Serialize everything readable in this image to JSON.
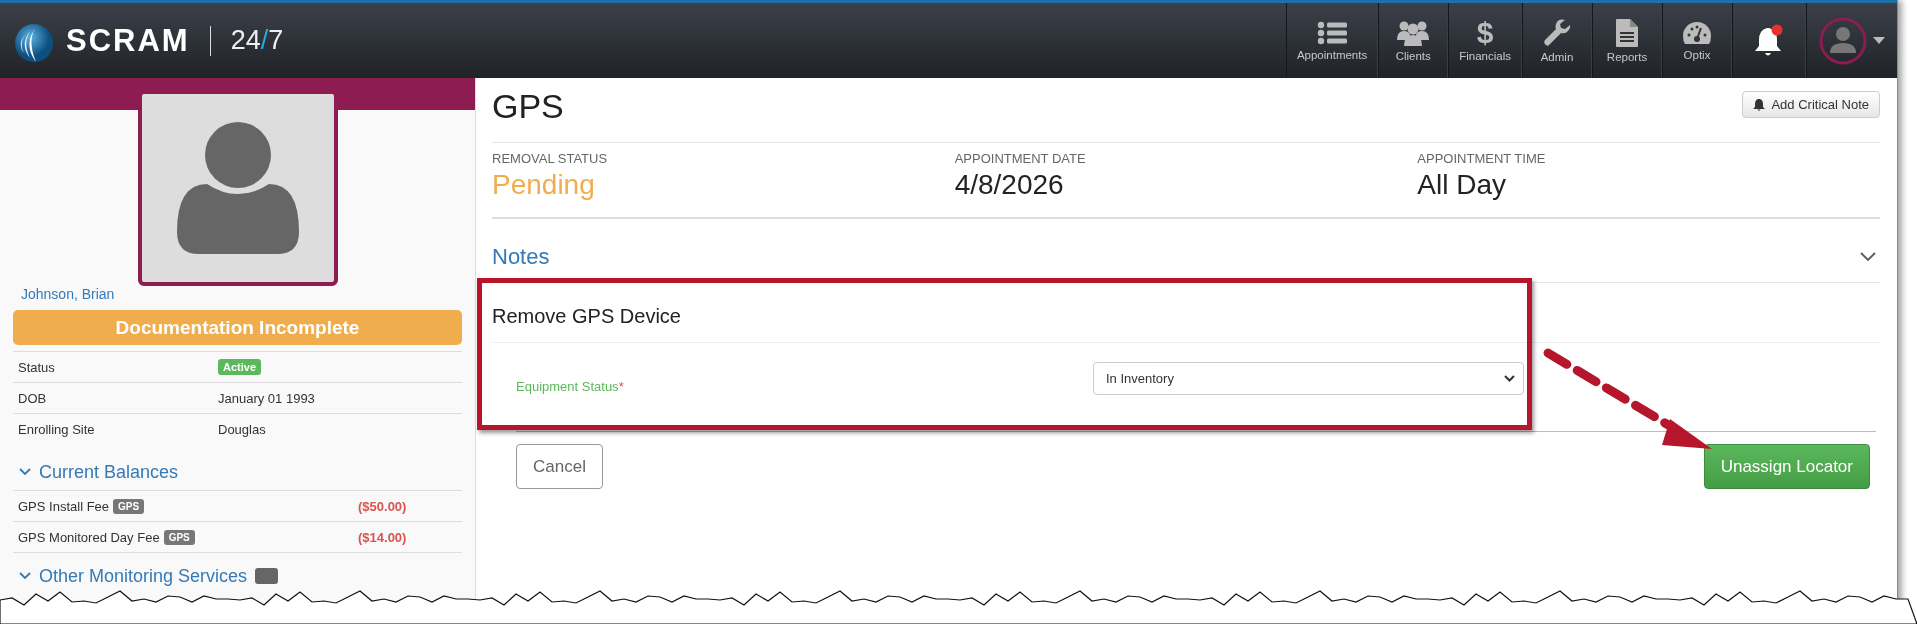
{
  "header": {
    "logo": {
      "brand": "SCRAM",
      "suffix": [
        {
          "text": "24",
          "accent": false
        },
        {
          "text": "/",
          "accent": true
        },
        {
          "text": "7",
          "accent": false
        }
      ]
    },
    "nav": [
      {
        "label": "Appointments"
      },
      {
        "label": "Clients"
      },
      {
        "label": "Financials",
        "icon_text": "$"
      },
      {
        "label": "Admin"
      },
      {
        "label": "Reports"
      },
      {
        "label": "Optix"
      }
    ],
    "notifications": {
      "unread": true
    }
  },
  "sidebar": {
    "client_name": "Johnson, Brian",
    "banner": "Documentation Incomplete",
    "details": [
      {
        "label": "Status",
        "value": "Active",
        "kind": "badge"
      },
      {
        "label": "DOB",
        "value": "January 01 1993",
        "kind": "text"
      },
      {
        "label": "Enrolling Site",
        "value": "Douglas",
        "kind": "text"
      }
    ],
    "balances": {
      "title": "Current Balances",
      "expanded": true,
      "items": [
        {
          "label": "GPS Install Fee",
          "tag": "GPS",
          "amount": "($50.00)"
        },
        {
          "label": "GPS Monitored Day Fee",
          "tag": "GPS",
          "amount": "($14.00)"
        }
      ]
    },
    "other_services": {
      "title": "Other Monitoring Services",
      "expanded": true
    }
  },
  "main": {
    "title": "GPS",
    "add_note_button": "Add Critical Note",
    "summary": [
      {
        "label": "REMOVAL STATUS",
        "value": "Pending",
        "kind": "status"
      },
      {
        "label": "APPOINTMENT DATE",
        "value": "4/8/2026",
        "kind": "plain"
      },
      {
        "label": "APPOINTMENT TIME",
        "value": "All Day",
        "kind": "plain"
      }
    ],
    "notes": {
      "title": "Notes",
      "expanded": false
    },
    "form": {
      "title": "Remove GPS Device",
      "field": {
        "label": "Equipment Status",
        "required_mark": "*",
        "value": "In Inventory"
      }
    },
    "buttons": [
      {
        "label": "Cancel",
        "kind": "secondary"
      },
      {
        "label": "Unassign Locator",
        "kind": "primary"
      }
    ]
  }
}
